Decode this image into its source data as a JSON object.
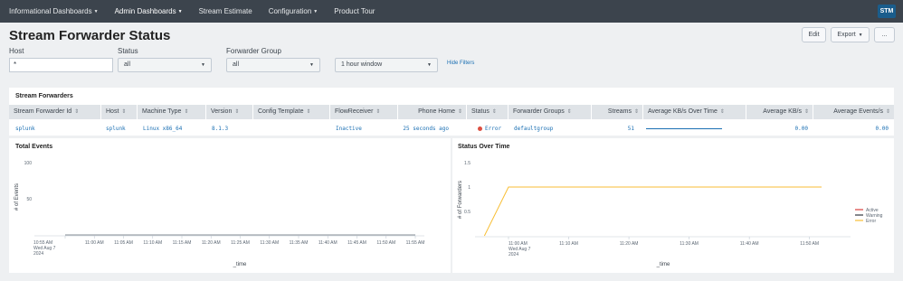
{
  "nav": {
    "items": [
      {
        "label": "Informational Dashboards",
        "dropdown": true,
        "active": false
      },
      {
        "label": "Admin Dashboards",
        "dropdown": true,
        "active": true
      },
      {
        "label": "Stream Estimate",
        "dropdown": false,
        "active": false
      },
      {
        "label": "Configuration",
        "dropdown": true,
        "active": false
      },
      {
        "label": "Product Tour",
        "dropdown": false,
        "active": false
      }
    ],
    "app_badge": "STM"
  },
  "page": {
    "title": "Stream Forwarder Status",
    "edit_label": "Edit",
    "export_label": "Export",
    "more_label": "..."
  },
  "filters": {
    "host_label": "Host",
    "host_value": "*",
    "status_label": "Status",
    "status_value": "all",
    "group_label": "Forwarder Group",
    "group_value": "all",
    "time_value": "1 hour window",
    "hide_filters_label": "Hide Filters"
  },
  "forwarders": {
    "title": "Stream Forwarders",
    "columns": [
      "Stream Forwarder Id",
      "Host",
      "Machine Type",
      "Version",
      "Config Template",
      "FlowReceiver",
      "Phone Home",
      "Status",
      "Forwarder Groups",
      "Streams",
      "Average KB/s Over Time",
      "Average KB/s",
      "Average Events/s"
    ],
    "row": {
      "id": "splunk",
      "host": "splunk",
      "machine_type": "Linux x86_64",
      "version": "8.1.3",
      "config_template": "",
      "flow_receiver": "Inactive",
      "phone_home": "25 seconds ago",
      "status": "Error",
      "forwarder_groups": "defaultgroup",
      "streams": "51",
      "avg_kbs": "0.00",
      "avg_events": "0.00"
    }
  },
  "colors": {
    "nav_bg": "#3c444d",
    "error": "#dc4e41",
    "link": "#1a6fb3",
    "active": "#d93f3c",
    "warning": "#31373e",
    "error_line": "#f8be34"
  },
  "charts": {
    "total_events": {
      "title": "Total Events",
      "ylabel": "# of Events",
      "xlabel": "_time",
      "first_tick_lines": [
        "10:55 AM",
        "Wed Aug 7",
        "2024"
      ]
    },
    "status_over_time": {
      "title": "Status Over Time",
      "ylabel": "# of Forwarders",
      "xlabel": "_time",
      "first_tick_lines": [
        "11:00 AM",
        "Wed Aug 7",
        "2024"
      ],
      "legend": [
        "Active",
        "Warning",
        "Error"
      ]
    }
  },
  "chart_data": [
    {
      "type": "line",
      "title": "Total Events",
      "xlabel": "_time",
      "ylabel": "# of Events",
      "x": [
        "10:55 AM",
        "11:00 AM",
        "11:05 AM",
        "11:10 AM",
        "11:15 AM",
        "11:20 AM",
        "11:25 AM",
        "11:30 AM",
        "11:35 AM",
        "11:40 AM",
        "11:45 AM",
        "11:50 AM",
        "11:55 AM"
      ],
      "yticks": [
        50,
        100
      ],
      "ylim": [
        0,
        100
      ],
      "series": [
        {
          "values": [
            0,
            0,
            0,
            0,
            0,
            0,
            0,
            0,
            0,
            0,
            0,
            0,
            0
          ]
        }
      ],
      "grid": false
    },
    {
      "type": "line",
      "title": "Status Over Time",
      "xlabel": "_time",
      "ylabel": "# of Forwarders",
      "x_ticks": [
        "11:00 AM",
        "11:10 AM",
        "11:20 AM",
        "11:30 AM",
        "11:40 AM",
        "11:50 AM"
      ],
      "yticks": [
        0.5,
        1,
        1.5
      ],
      "ylim": [
        0,
        1.5
      ],
      "series": [
        {
          "name": "Active",
          "points": []
        },
        {
          "name": "Warning",
          "points": []
        },
        {
          "name": "Error",
          "points": [
            [
              "10:56 AM",
              0
            ],
            [
              "11:00 AM",
              1
            ],
            [
              "11:52 AM",
              1
            ]
          ]
        }
      ],
      "legend": "right",
      "grid": false
    }
  ]
}
